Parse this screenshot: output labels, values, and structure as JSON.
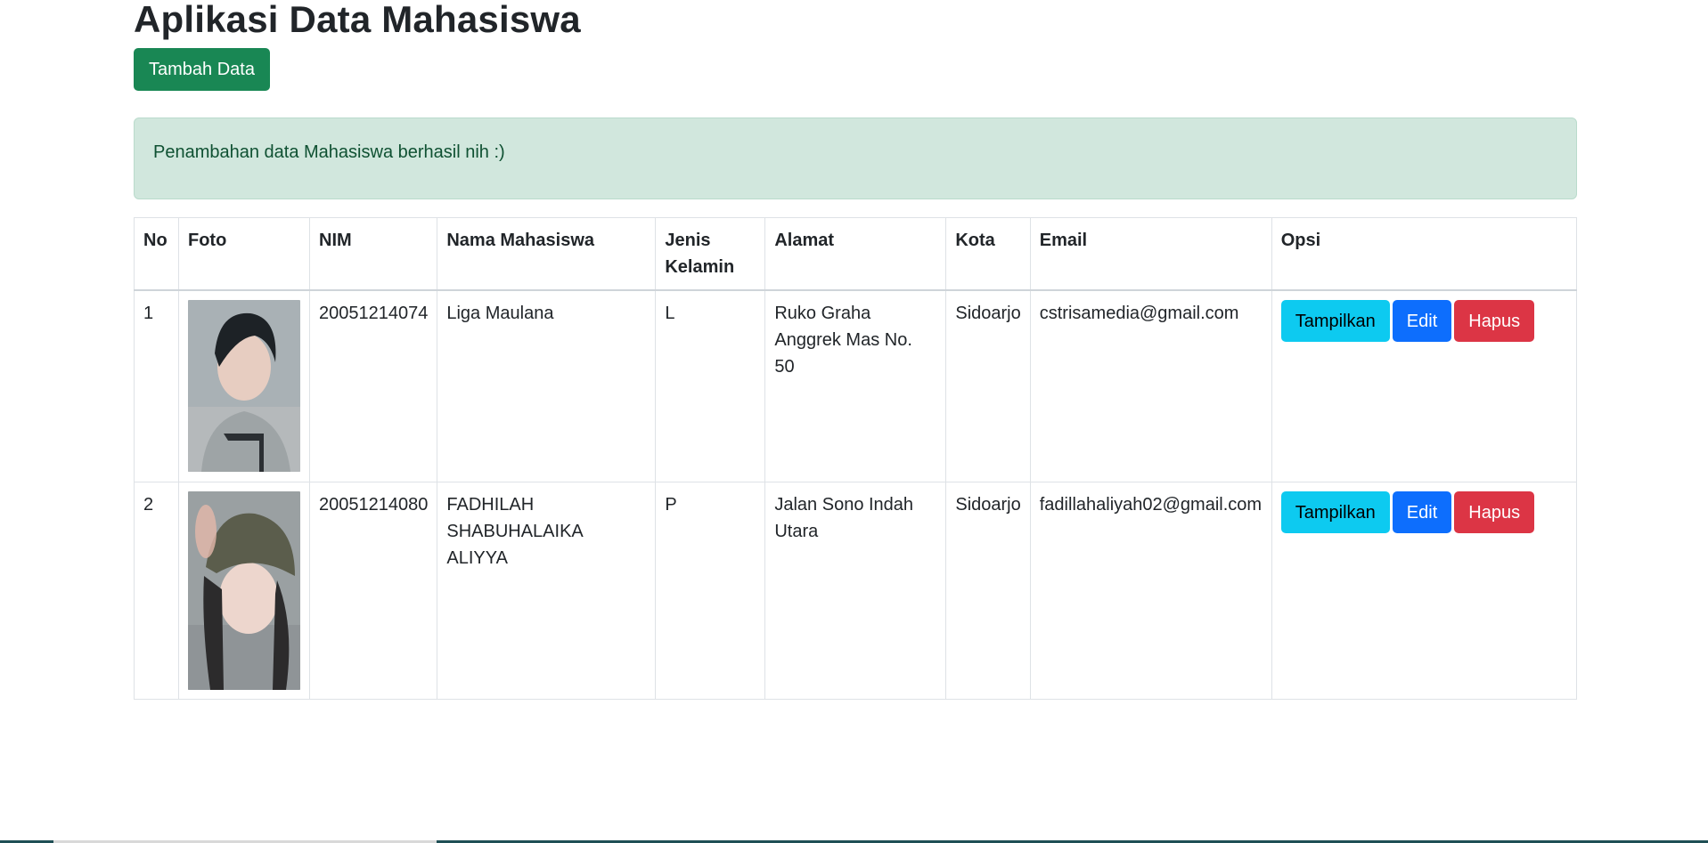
{
  "page": {
    "title": "Aplikasi Data Mahasiswa",
    "add_button": "Tambah Data",
    "alert": "Penambahan data Mahasiswa berhasil nih :)"
  },
  "table": {
    "headers": [
      "No",
      "Foto",
      "NIM",
      "Nama Mahasiswa",
      "Jenis Kelamin",
      "Alamat",
      "Kota",
      "Email",
      "Opsi"
    ],
    "rows": [
      {
        "no": "1",
        "foto": "photo-male",
        "nim": "20051214074",
        "nama": "Liga Maulana",
        "jk": "L",
        "alamat": "Ruko Graha Anggrek Mas No. 50",
        "kota": "Sidoarjo",
        "email": "cstrisamedia@gmail.com"
      },
      {
        "no": "2",
        "foto": "photo-female",
        "nim": "20051214080",
        "nama": "FADHILAH SHABUHALAIKA ALIYYA",
        "jk": "P",
        "alamat": "Jalan Sono Indah Utara",
        "kota": "Sidoarjo",
        "email": "fadillahaliyah02@gmail.com"
      }
    ],
    "actions": {
      "show": "Tampilkan",
      "edit": "Edit",
      "delete": "Hapus"
    }
  },
  "colors": {
    "success": "#198754",
    "info": "#0dcaf0",
    "primary": "#0d6efd",
    "danger": "#dc3545",
    "alert_bg": "#d1e7dd"
  }
}
